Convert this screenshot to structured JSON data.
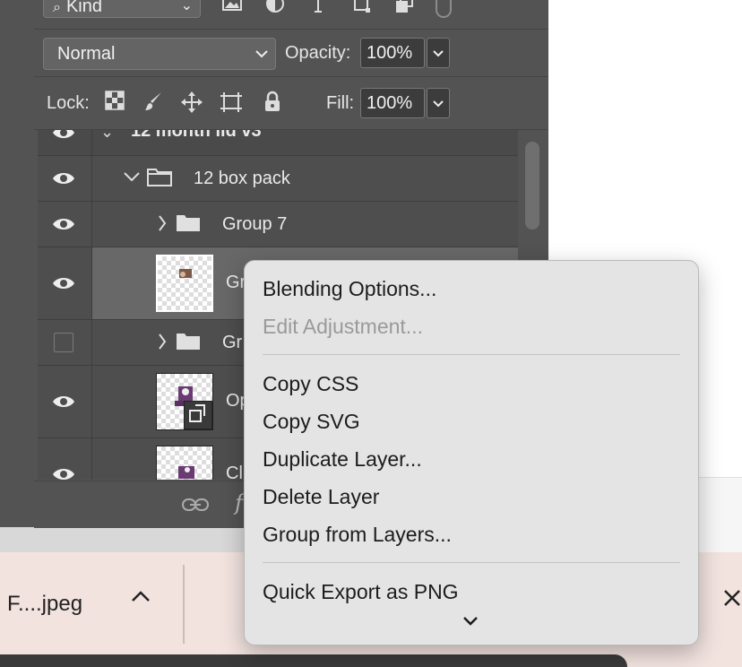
{
  "filter": {
    "kind_label": "Kind"
  },
  "blend": {
    "mode": "Normal",
    "opacity_label": "Opacity:",
    "opacity_value": "100%"
  },
  "lock": {
    "label": "Lock:",
    "fill_label": "Fill:",
    "fill_value": "100%"
  },
  "layers": [
    {
      "name": "12 month lid v3"
    },
    {
      "name": "12 box pack"
    },
    {
      "name": "Group 7"
    },
    {
      "name": "Gr"
    },
    {
      "name": "Gr"
    },
    {
      "name": "Op"
    },
    {
      "name": "Cl"
    }
  ],
  "context_menu": {
    "items": [
      {
        "label": "Blending Options..."
      },
      {
        "label": "Edit Adjustment..."
      },
      {
        "label": "Copy CSS"
      },
      {
        "label": "Copy SVG"
      },
      {
        "label": "Duplicate Layer..."
      },
      {
        "label": "Delete Layer"
      },
      {
        "label": "Group from Layers..."
      },
      {
        "label": "Quick Export as PNG"
      }
    ]
  },
  "download_bar": {
    "file_name": "F....jpeg",
    "caret": "^",
    "close": "✕"
  },
  "colors": {
    "panel_bg": "#535353",
    "menu_bg": "#e4e4e4",
    "download_bar_bg": "#f2e3df"
  }
}
